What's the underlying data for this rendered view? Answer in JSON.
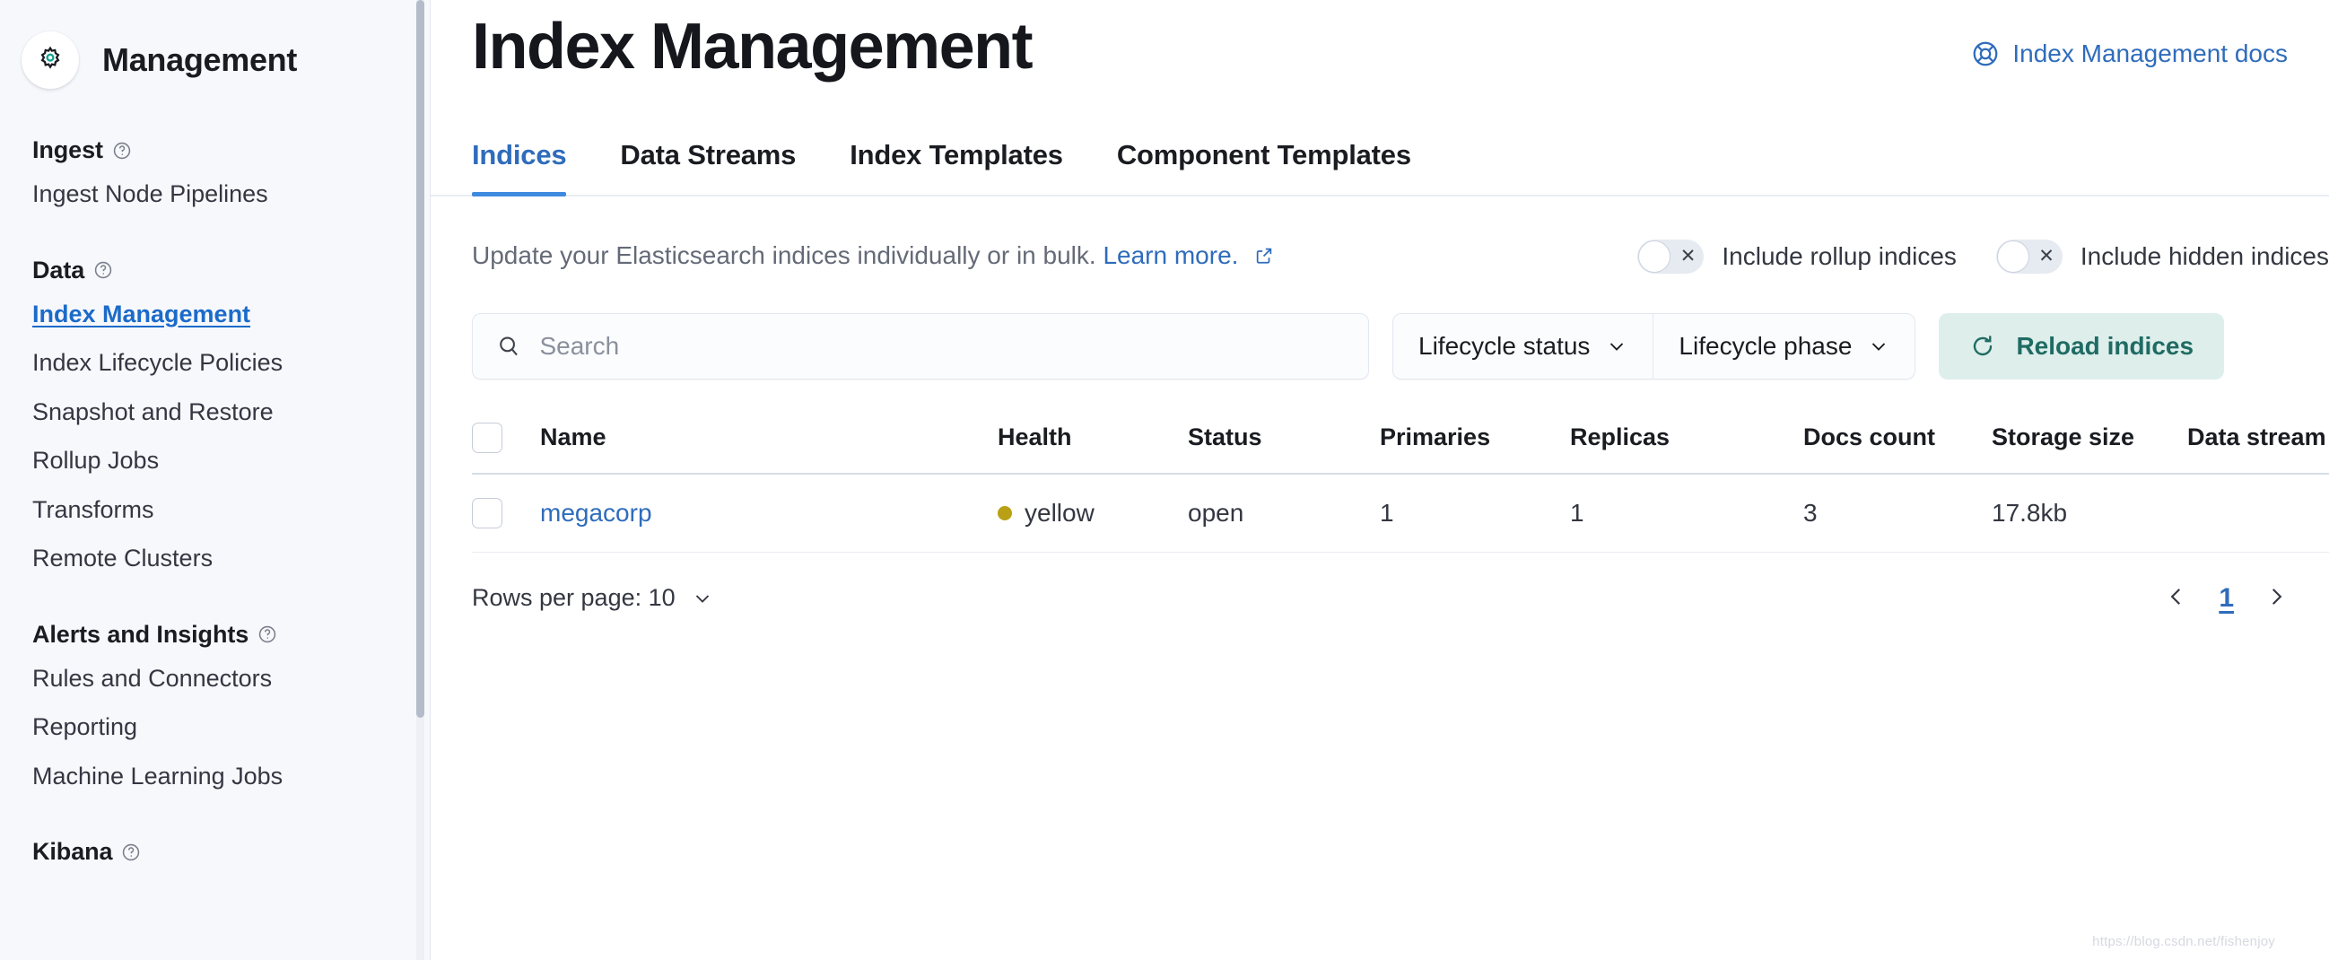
{
  "sidebar": {
    "brand_title": "Management",
    "brand_icon": "gear-icon",
    "groups": [
      {
        "title": "Ingest",
        "help_icon": "help-circle-icon",
        "items": [
          {
            "label": "Ingest Node Pipelines",
            "active": false
          }
        ]
      },
      {
        "title": "Data",
        "help_icon": "help-circle-icon",
        "items": [
          {
            "label": "Index Management",
            "active": true
          },
          {
            "label": "Index Lifecycle Policies",
            "active": false
          },
          {
            "label": "Snapshot and Restore",
            "active": false
          },
          {
            "label": "Rollup Jobs",
            "active": false
          },
          {
            "label": "Transforms",
            "active": false
          },
          {
            "label": "Remote Clusters",
            "active": false
          }
        ]
      },
      {
        "title": "Alerts and Insights",
        "help_icon": "help-circle-icon",
        "items": [
          {
            "label": "Rules and Connectors",
            "active": false
          },
          {
            "label": "Reporting",
            "active": false
          },
          {
            "label": "Machine Learning Jobs",
            "active": false
          }
        ]
      },
      {
        "title": "Kibana",
        "help_icon": "help-circle-icon",
        "items": []
      }
    ]
  },
  "header": {
    "title": "Index Management",
    "docs_link_label": "Index Management docs",
    "docs_link_icon": "lifebuoy-icon"
  },
  "tabs": [
    {
      "label": "Indices",
      "selected": true
    },
    {
      "label": "Data Streams",
      "selected": false
    },
    {
      "label": "Index Templates",
      "selected": false
    },
    {
      "label": "Component Templates",
      "selected": false
    }
  ],
  "description": {
    "text": "Update your Elasticsearch indices individually or in bulk.",
    "link_label": "Learn more.",
    "link_icon": "external-link-icon"
  },
  "switches": [
    {
      "label": "Include rollup indices",
      "on": false,
      "state_icon": "cross-icon"
    },
    {
      "label": "Include hidden indices",
      "on": false,
      "state_icon": "cross-icon"
    }
  ],
  "search": {
    "placeholder": "Search",
    "value": "",
    "icon": "search-icon"
  },
  "filters": [
    {
      "label": "Lifecycle status",
      "icon": "chevron-down-icon"
    },
    {
      "label": "Lifecycle phase",
      "icon": "chevron-down-icon"
    }
  ],
  "reload_button": {
    "label": "Reload indices",
    "icon": "refresh-icon",
    "bg_color": "#ddeeeb",
    "text_color": "#1f6b63"
  },
  "table": {
    "columns": [
      "Name",
      "Health",
      "Status",
      "Primaries",
      "Replicas",
      "Docs count",
      "Storage size",
      "Data stream"
    ],
    "rows": [
      {
        "name": "megacorp",
        "health": "yellow",
        "health_color": "#b9a014",
        "status": "open",
        "primaries": "1",
        "replicas": "1",
        "docs_count": "3",
        "storage_size": "17.8kb",
        "data_stream": ""
      }
    ]
  },
  "pagination": {
    "rows_per_page_label": "Rows per page: 10",
    "rows_per_page_icon": "chevron-down-icon",
    "prev_icon": "chevron-left-icon",
    "next_icon": "chevron-right-icon",
    "current_page": "1"
  },
  "watermark": "https://blog.csdn.net/fishenjoy"
}
